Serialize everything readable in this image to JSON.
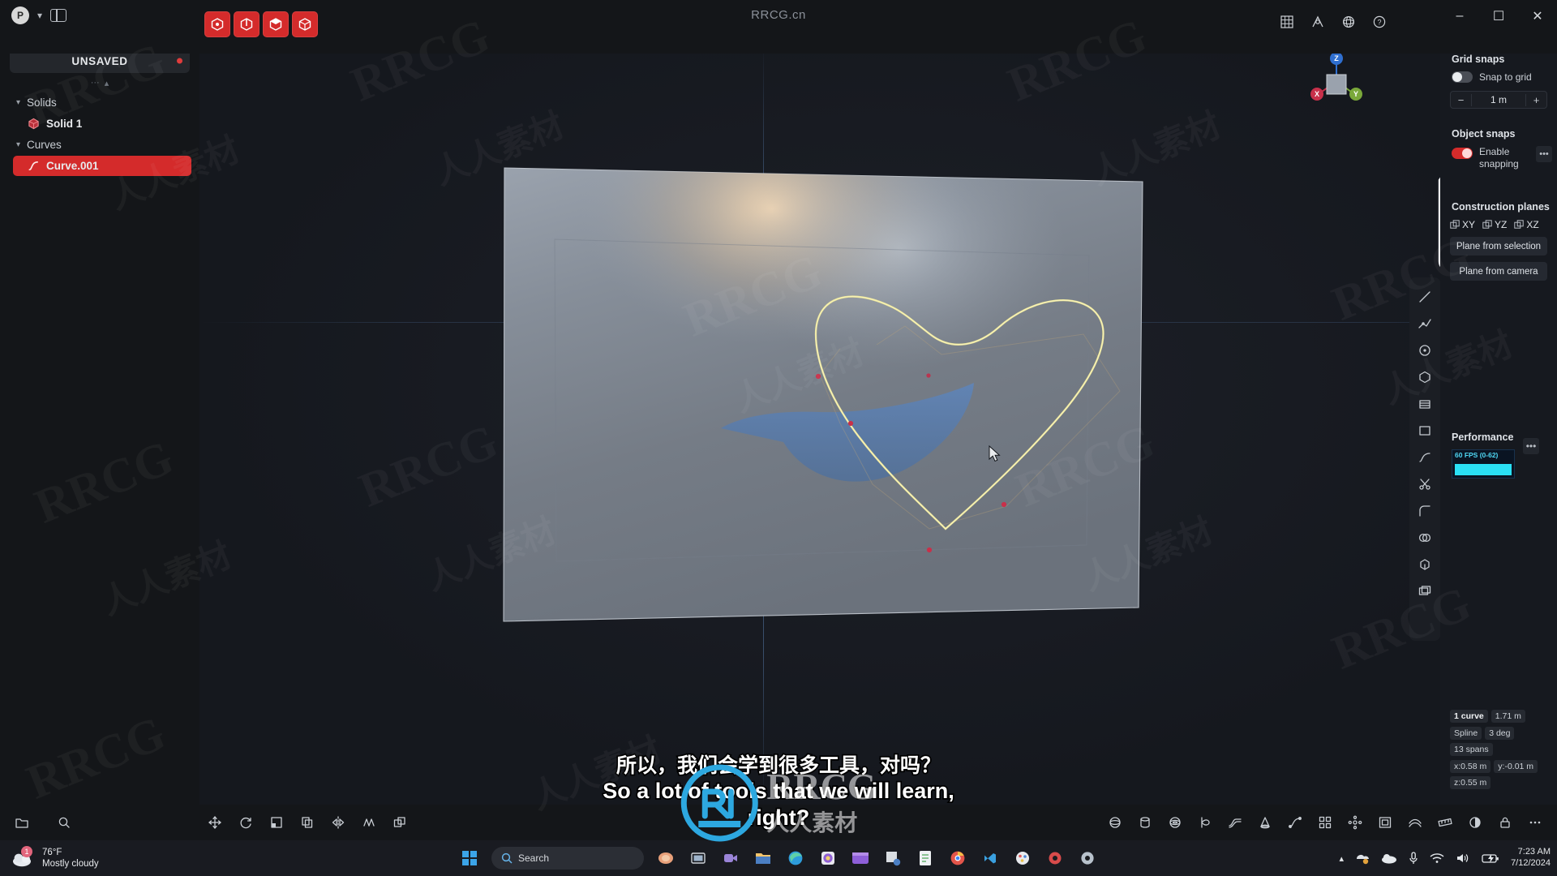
{
  "app": {
    "center_title": "RRCG.cn"
  },
  "titlebar": {
    "avatar_initial": "P",
    "chevron_icon": "chevron-down-icon",
    "panel_toggle_icon": "toggle-sidebar-icon",
    "minimize_label": "–",
    "maximize_label": "☐",
    "close_label": "✕"
  },
  "mode_buttons": [
    {
      "name": "select-points",
      "icon": "hexagon-point-icon"
    },
    {
      "name": "select-edges",
      "icon": "hexagon-edge-icon"
    },
    {
      "name": "select-faces",
      "icon": "cube-face-icon"
    },
    {
      "name": "select-solids",
      "icon": "cube-solid-icon"
    }
  ],
  "view_icons": [
    {
      "name": "grid-view-icon",
      "glyph": "grid"
    },
    {
      "name": "isolate-icon",
      "glyph": "isolate"
    },
    {
      "name": "xray-icon",
      "glyph": "xray"
    },
    {
      "name": "help-icon",
      "glyph": "question"
    }
  ],
  "sidebar": {
    "file_status": "UNSAVED",
    "modified_dot": true,
    "groups": [
      {
        "label": "Solids",
        "expanded": true,
        "items": [
          {
            "label": "Solid 1",
            "icon": "solid-icon",
            "selected": false
          }
        ]
      },
      {
        "label": "Curves",
        "expanded": true,
        "items": [
          {
            "label": "Curve.001",
            "icon": "curve-icon",
            "selected": true
          }
        ]
      }
    ]
  },
  "right_panel": {
    "grid_snaps": {
      "title": "Grid snaps",
      "snap_to_grid_label": "Snap to grid",
      "snap_to_grid_enabled": false,
      "step_minus": "−",
      "step_value": "1 m",
      "step_plus": "+"
    },
    "object_snaps": {
      "title": "Object snaps",
      "enable_label": "Enable snapping",
      "enabled": true,
      "more_label": "•••"
    },
    "construction_planes": {
      "title": "Construction planes",
      "planes": [
        "XY",
        "YZ",
        "XZ"
      ],
      "buttons": [
        "Plane from selection",
        "Plane from camera"
      ]
    },
    "performance": {
      "title": "Performance",
      "fps_label": "60 FPS (0-62)",
      "more_label": "•••"
    },
    "selection_info": {
      "rows": [
        [
          {
            "text": "1 curve",
            "strong": true
          },
          {
            "text": "1.71 m",
            "strong": false
          }
        ],
        [
          {
            "text": "Spline",
            "strong": false
          },
          {
            "text": "3 deg",
            "strong": false
          },
          {
            "text": "13 spans",
            "strong": false
          }
        ],
        [
          {
            "text": "x:0.58 m",
            "strong": false
          },
          {
            "text": "y:-0.01 m",
            "strong": false
          },
          {
            "text": "z:0.55 m",
            "strong": false
          }
        ]
      ]
    }
  },
  "right_toolbar": [
    {
      "name": "line-tool",
      "icon": "line-icon"
    },
    {
      "name": "polyline-tool",
      "icon": "polyline-icon"
    },
    {
      "name": "circle-tool",
      "icon": "circle-icon"
    },
    {
      "name": "polygon-tool",
      "icon": "polygon-icon"
    },
    {
      "name": "box-tool",
      "icon": "box-icon"
    },
    {
      "name": "rectangle-tool",
      "icon": "rectangle-icon"
    },
    {
      "name": "curve-tool",
      "icon": "spline-icon"
    },
    {
      "name": "trim-tool",
      "icon": "scissors-icon"
    },
    {
      "name": "fillet-tool",
      "icon": "fillet-icon"
    },
    {
      "name": "boolean-tool",
      "icon": "boolean-icon"
    },
    {
      "name": "extrude-tool",
      "icon": "extrude-icon"
    },
    {
      "name": "offset-tool",
      "icon": "offset-icon"
    }
  ],
  "bottom_toolbar": {
    "left": [
      {
        "name": "open-folder-button",
        "icon": "folder-icon"
      },
      {
        "name": "zoom-button",
        "icon": "magnifier-icon"
      }
    ],
    "middle": [
      {
        "name": "move-tool",
        "icon": "move-icon"
      },
      {
        "name": "rotate-tool",
        "icon": "rotate-icon"
      },
      {
        "name": "scale-tool",
        "icon": "scale-icon"
      },
      {
        "name": "copy-tool",
        "icon": "copy-icon"
      },
      {
        "name": "mirror-tool",
        "icon": "mirror-icon"
      },
      {
        "name": "array-tool",
        "icon": "array-icon"
      },
      {
        "name": "duplicate-tool",
        "icon": "duplicate-icon"
      }
    ],
    "right": [
      {
        "name": "sphere-primitive",
        "icon": "sphere-icon"
      },
      {
        "name": "cylinder-primitive",
        "icon": "cylinder-icon"
      },
      {
        "name": "torus-primitive",
        "icon": "torus-icon"
      },
      {
        "name": "revolve-tool",
        "icon": "revolve-icon"
      },
      {
        "name": "loft-tool",
        "icon": "loft-icon"
      },
      {
        "name": "cone-primitive",
        "icon": "cone-icon"
      },
      {
        "name": "sweep-tool",
        "icon": "sweep-icon"
      },
      {
        "name": "pattern-tool",
        "icon": "pattern-icon"
      },
      {
        "name": "radial-array-tool",
        "icon": "radial-array-icon"
      },
      {
        "name": "shell-tool",
        "icon": "shell-icon"
      },
      {
        "name": "thicken-tool",
        "icon": "thicken-icon"
      },
      {
        "name": "measure-tool",
        "icon": "measure-icon"
      },
      {
        "name": "material-tool",
        "icon": "material-icon"
      },
      {
        "name": "lock-tool",
        "icon": "lock-icon"
      },
      {
        "name": "more-tools",
        "icon": "ellipsis-icon"
      }
    ]
  },
  "subtitles": {
    "line_cn": "所以，我们会学到很多工具，对吗？",
    "line_en_1": "So a lot of tools that we will learn,",
    "line_en_2": "right?"
  },
  "taskbar": {
    "weather_temp": "76°F",
    "weather_desc": "Mostly cloudy",
    "weather_badge": "1",
    "start_icon": "windows-start-icon",
    "search_placeholder": "Search",
    "search_icon": "search-icon",
    "apps": [
      {
        "name": "copilot-icon"
      },
      {
        "name": "task-view-icon"
      },
      {
        "name": "teams-icon"
      },
      {
        "name": "file-explorer-icon"
      },
      {
        "name": "edge-icon"
      },
      {
        "name": "photos-icon"
      },
      {
        "name": "video-editor-icon"
      },
      {
        "name": "screenshot-tool-icon"
      },
      {
        "name": "notepad-icon"
      },
      {
        "name": "chrome-icon"
      },
      {
        "name": "vscode-icon"
      },
      {
        "name": "paint-icon"
      },
      {
        "name": "plasticity-icon"
      },
      {
        "name": "settings-icon"
      }
    ],
    "tray": {
      "overflow_icon": "chevron-up-icon",
      "onedrive_icon": "onedrive-sync-icon",
      "cloud_icon": "cloud-icon",
      "mic_icon": "microphone-icon",
      "wifi_icon": "wifi-icon",
      "volume_icon": "speaker-icon",
      "battery_icon": "battery-icon",
      "time": "7:23 AM",
      "date": "7/12/2024"
    }
  },
  "watermarks": {
    "brand": "RRCG",
    "brand_cn": "人人素材",
    "logo_text": "RRCG"
  }
}
